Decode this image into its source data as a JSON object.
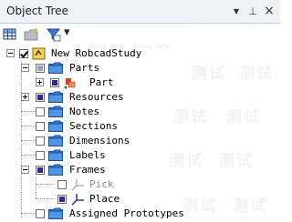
{
  "window": {
    "title": "Object Tree",
    "menu_glyph": "▼",
    "pin_glyph": "⊥",
    "close_glyph": "×"
  },
  "toolbar": {
    "items": [
      "grid-icon",
      "folder-icon",
      "filter-icon",
      "dropdown-icon"
    ],
    "dropdown_glyph": "▾"
  },
  "tree": {
    "root": "New RobcadStudy",
    "parts": "Parts",
    "part": "Part",
    "resources": "Resources",
    "notes": "Notes",
    "sections": "Sections",
    "dimensions": "Dimensions",
    "labels": "Labels",
    "frames": "Frames",
    "pick": "Pick",
    "place": "Place",
    "assigned_prototypes": "Assigned Prototypes"
  },
  "watermark": "测试",
  "colors": {
    "titlebar_bg": "#eef1f6",
    "folder_fill": "#2f7fd6",
    "checkbox_full": "#2a2aa0",
    "checkbox_partial": "#9c9ccf"
  }
}
